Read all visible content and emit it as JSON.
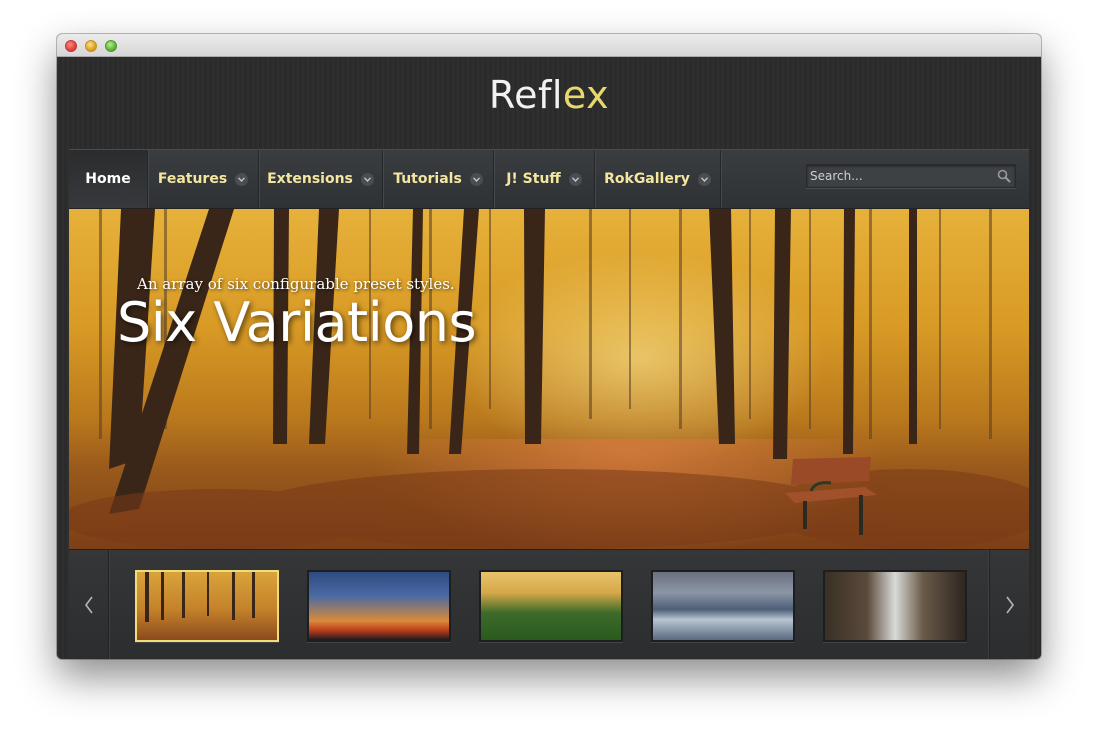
{
  "site": {
    "logo_main": "Refl",
    "logo_accent": "ex"
  },
  "nav": {
    "items": [
      {
        "label": "Home",
        "active": true,
        "dropdown": false
      },
      {
        "label": "Features",
        "dropdown": true
      },
      {
        "label": "Extensions",
        "dropdown": true
      },
      {
        "label": "Tutorials",
        "dropdown": true
      },
      {
        "label": "J! Stuff",
        "dropdown": true
      },
      {
        "label": "RokGallery",
        "dropdown": true
      }
    ],
    "search_placeholder": "Search..."
  },
  "hero": {
    "subtitle": "An array of six configurable preset styles.",
    "title": "Six Variations"
  },
  "gallery": {
    "thumbnails": [
      "autumn-forest",
      "sunset-clouds",
      "green-field",
      "mountain-lake",
      "waterfall"
    ],
    "active_index": 0
  },
  "colors": {
    "nav_text": "#f3e6a0",
    "accent": "#e8d96a",
    "active_thumb_border": "#f1dc7a"
  }
}
